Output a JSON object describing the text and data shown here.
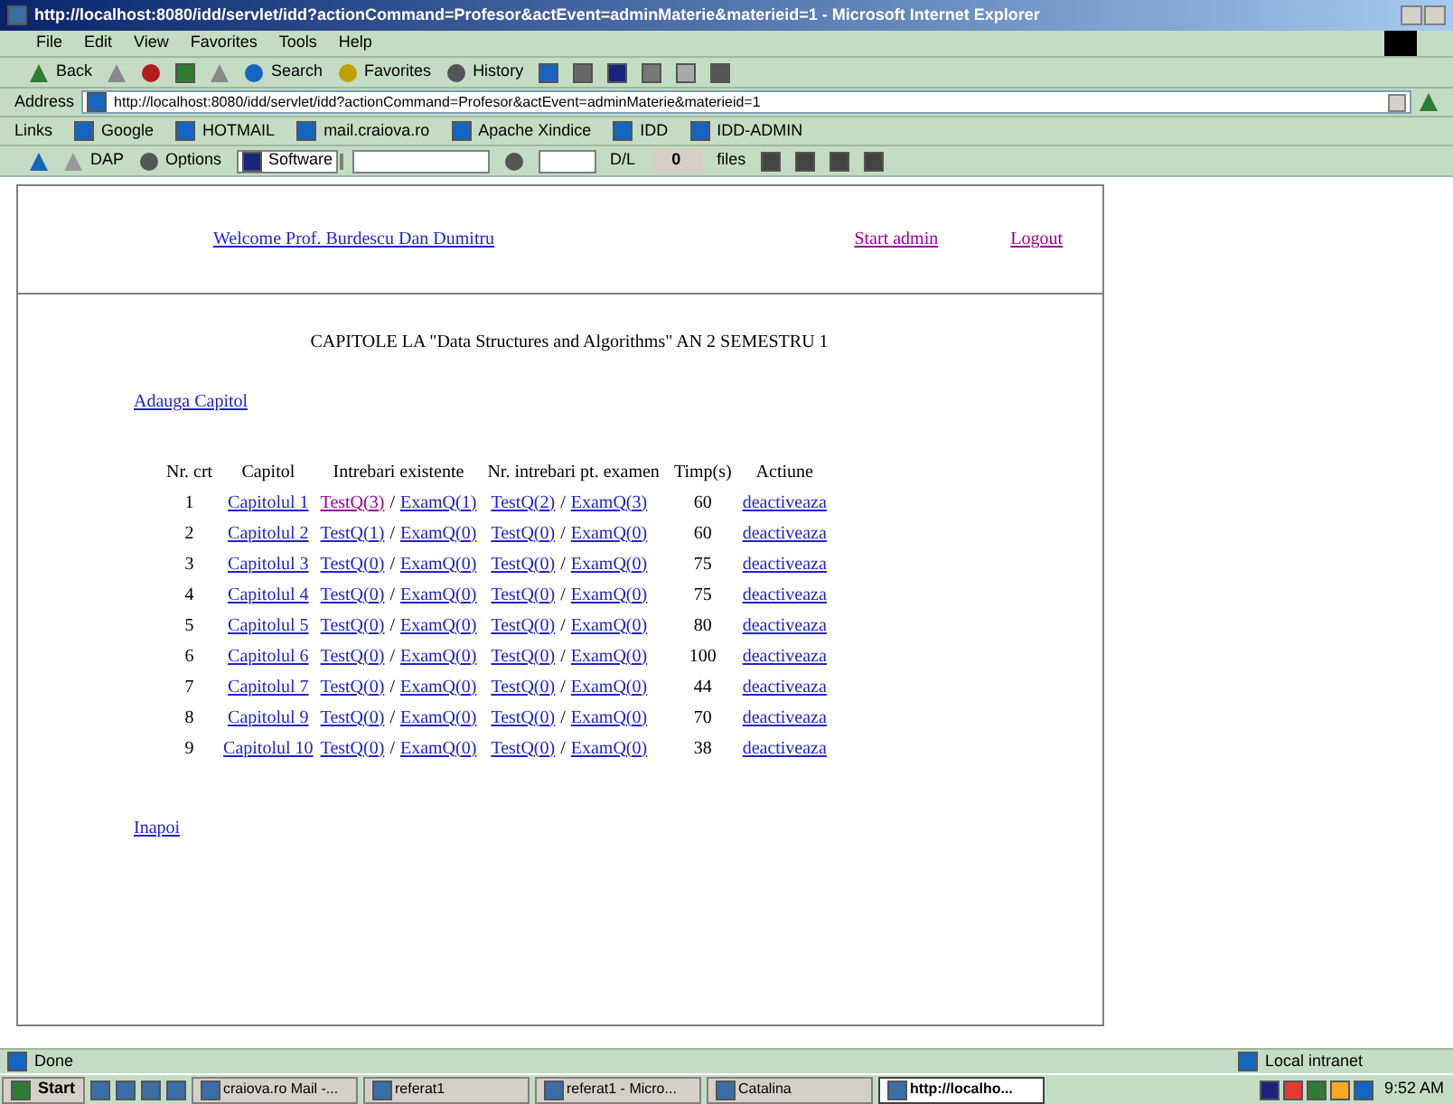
{
  "window": {
    "title": "http://localhost:8080/idd/servlet/idd?actionCommand=Profesor&actEvent=adminMaterie&materieid=1 - Microsoft Internet Explorer"
  },
  "menu": [
    "File",
    "Edit",
    "View",
    "Favorites",
    "Tools",
    "Help"
  ],
  "toolbar": [
    "Back",
    "Search",
    "Favorites",
    "History"
  ],
  "address": {
    "label": "Address",
    "value": "http://localhost:8080/idd/servlet/idd?actionCommand=Profesor&actEvent=adminMaterie&materieid=1"
  },
  "links": {
    "label": "Links",
    "items": [
      "Google",
      "HOTMAIL",
      "mail.craiova.ro",
      "Apache Xindice",
      "IDD",
      "IDD-ADMIN"
    ]
  },
  "toolbar2": {
    "dap": "DAP",
    "options": "Options",
    "software": "Software",
    "dl": "D/L",
    "count": "0",
    "files": "files"
  },
  "header": {
    "welcome": {
      "text": "Welcome Prof. Burdescu Dan Dumitru",
      "visited": false
    },
    "start": {
      "text": "Start admin",
      "visited": true
    },
    "logout": {
      "text": "Logout",
      "visited": true
    }
  },
  "heading": "CAPITOLE LA \"Data Structures and Algorithms\" AN 2 SEMESTRU 1",
  "add_link": "Adauga Capitol",
  "table": {
    "columns": [
      "Nr. crt",
      "Capitol",
      "Intrebari existente",
      "Nr. intrebari pt. examen",
      "Timp(s)",
      "Actiune"
    ],
    "rows": [
      {
        "nr": "1",
        "capitol": "Capitolul 1",
        "existing": [
          {
            "text": "TestQ(3)",
            "visited": true
          },
          {
            "text": "/",
            "kind": "text"
          },
          {
            "text": "ExamQ(1)",
            "visited": false
          }
        ],
        "exam": [
          {
            "text": "TestQ(2)",
            "visited": false
          },
          {
            "text": "/",
            "kind": "text"
          },
          {
            "text": "ExamQ(3)",
            "visited": false
          }
        ],
        "time": "60",
        "action": "deactiveaza"
      },
      {
        "nr": "2",
        "capitol": "Capitolul 2",
        "existing": [
          {
            "text": "TestQ(1)",
            "visited": false
          },
          {
            "text": "/",
            "kind": "text"
          },
          {
            "text": "ExamQ(0)",
            "visited": false
          }
        ],
        "exam": [
          {
            "text": "TestQ(0)",
            "visited": false
          },
          {
            "text": "/",
            "kind": "text"
          },
          {
            "text": "ExamQ(0)",
            "visited": false
          }
        ],
        "time": "60",
        "action": "deactiveaza"
      },
      {
        "nr": "3",
        "capitol": "Capitolul 3",
        "existing": [
          {
            "text": "TestQ(0)",
            "visited": false
          },
          {
            "text": "/",
            "kind": "text"
          },
          {
            "text": "ExamQ(0)",
            "visited": false
          }
        ],
        "exam": [
          {
            "text": "TestQ(0)",
            "visited": false
          },
          {
            "text": "/",
            "kind": "text"
          },
          {
            "text": "ExamQ(0)",
            "visited": false
          }
        ],
        "time": "75",
        "action": "deactiveaza"
      },
      {
        "nr": "4",
        "capitol": "Capitolul 4",
        "existing": [
          {
            "text": "TestQ(0)",
            "visited": false
          },
          {
            "text": "/",
            "kind": "text"
          },
          {
            "text": "ExamQ(0)",
            "visited": false
          }
        ],
        "exam": [
          {
            "text": "TestQ(0)",
            "visited": false
          },
          {
            "text": "/",
            "kind": "text"
          },
          {
            "text": "ExamQ(0)",
            "visited": false
          }
        ],
        "time": "75",
        "action": "deactiveaza"
      },
      {
        "nr": "5",
        "capitol": "Capitolul 5",
        "existing": [
          {
            "text": "TestQ(0)",
            "visited": false
          },
          {
            "text": "/",
            "kind": "text"
          },
          {
            "text": "ExamQ(0)",
            "visited": false
          }
        ],
        "exam": [
          {
            "text": "TestQ(0)",
            "visited": false
          },
          {
            "text": "/",
            "kind": "text"
          },
          {
            "text": "ExamQ(0)",
            "visited": false
          }
        ],
        "time": "80",
        "action": "deactiveaza"
      },
      {
        "nr": "6",
        "capitol": "Capitolul 6",
        "existing": [
          {
            "text": "TestQ(0)",
            "visited": false
          },
          {
            "text": "/",
            "kind": "text"
          },
          {
            "text": "ExamQ(0)",
            "visited": false
          }
        ],
        "exam": [
          {
            "text": "TestQ(0)",
            "visited": false
          },
          {
            "text": "/",
            "kind": "text"
          },
          {
            "text": "ExamQ(0)",
            "visited": false
          }
        ],
        "time": "100",
        "action": "deactiveaza"
      },
      {
        "nr": "7",
        "capitol": "Capitolul 7",
        "existing": [
          {
            "text": "TestQ(0)",
            "visited": false
          },
          {
            "text": "/",
            "kind": "text"
          },
          {
            "text": "ExamQ(0)",
            "visited": false
          }
        ],
        "exam": [
          {
            "text": "TestQ(0)",
            "visited": false
          },
          {
            "text": "/",
            "kind": "text"
          },
          {
            "text": "ExamQ(0)",
            "visited": false
          }
        ],
        "time": "44",
        "action": "deactiveaza"
      },
      {
        "nr": "8",
        "capitol": "Capitolul 9",
        "existing": [
          {
            "text": "TestQ(0)",
            "visited": false
          },
          {
            "text": "/",
            "kind": "text"
          },
          {
            "text": "ExamQ(0)",
            "visited": false
          }
        ],
        "exam": [
          {
            "text": "TestQ(0)",
            "visited": false
          },
          {
            "text": "/",
            "kind": "text"
          },
          {
            "text": "ExamQ(0)",
            "visited": false
          }
        ],
        "time": "70",
        "action": "deactiveaza"
      },
      {
        "nr": "9",
        "capitol": "Capitolul 10",
        "existing": [
          {
            "text": "TestQ(0)",
            "visited": false
          },
          {
            "text": "/",
            "kind": "text"
          },
          {
            "text": "ExamQ(0)",
            "visited": false
          }
        ],
        "exam": [
          {
            "text": "TestQ(0)",
            "visited": false
          },
          {
            "text": "/",
            "kind": "text"
          },
          {
            "text": "ExamQ(0)",
            "visited": false
          }
        ],
        "time": "38",
        "action": "deactiveaza"
      }
    ]
  },
  "back_link": "Inapoi",
  "status_bar": {
    "text": "Done",
    "zone": "Local intranet"
  },
  "taskbar": {
    "start": "Start",
    "items": [
      {
        "text": "craiova.ro Mail -...",
        "selected": false
      },
      {
        "text": "referat1",
        "selected": false
      },
      {
        "text": "referat1 - Micro...",
        "selected": false
      },
      {
        "text": "Catalina",
        "selected": false
      },
      {
        "text": "http://localho...",
        "selected": true
      }
    ],
    "clock": "9:52 AM"
  }
}
